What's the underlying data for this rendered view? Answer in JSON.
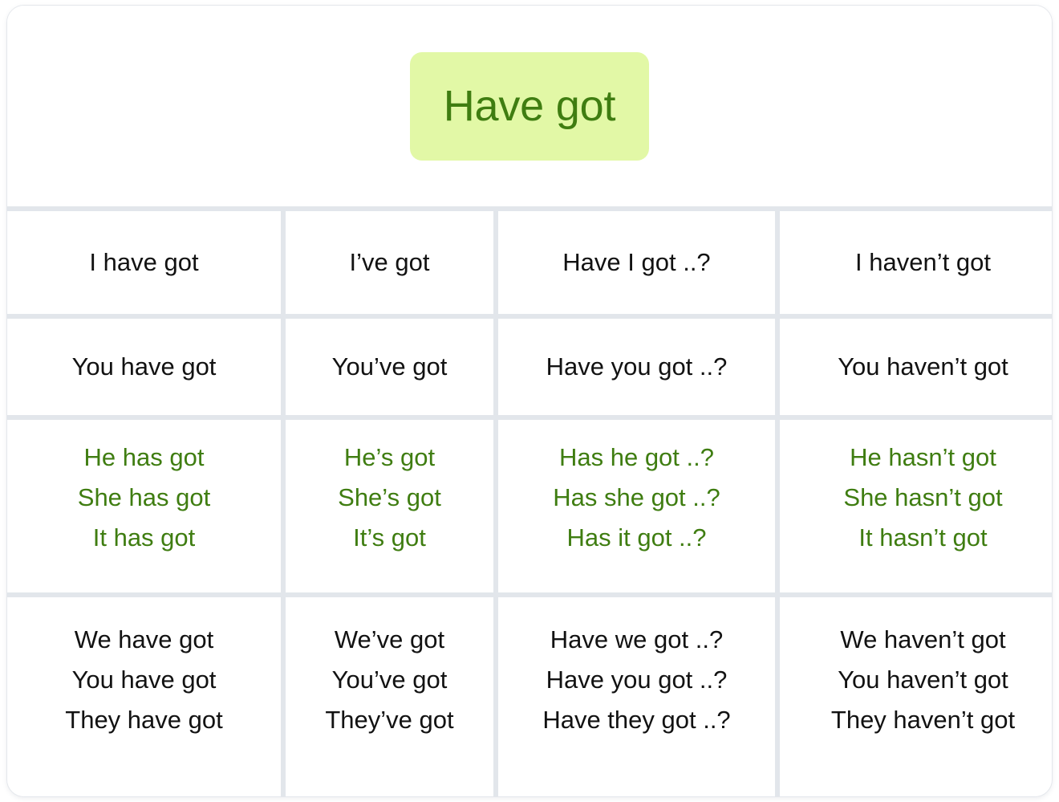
{
  "header": {
    "title": "Have got",
    "badge_bg_color": "#e2f8a6",
    "badge_text_color": "#3f7d11"
  },
  "colors": {
    "grid_line": "#e2e6eb",
    "cell_bg": "#ffffff",
    "text_default": "#121212",
    "text_green": "#3f7d11",
    "card_bg": "#ffffff"
  },
  "table": {
    "columns": [
      "affirmative-long",
      "affirmative-short",
      "question",
      "negative"
    ],
    "rows": [
      {
        "id": "row-1st-person-singular",
        "color": "default",
        "cells": [
          {
            "lines": [
              "I have got"
            ]
          },
          {
            "lines": [
              "I’ve got"
            ]
          },
          {
            "lines": [
              "Have I got ..?"
            ]
          },
          {
            "lines": [
              "I haven’t got"
            ]
          }
        ]
      },
      {
        "id": "row-2nd-person-singular",
        "color": "default",
        "cells": [
          {
            "lines": [
              "You have got"
            ]
          },
          {
            "lines": [
              "You’ve got"
            ]
          },
          {
            "lines": [
              "Have you got ..?"
            ]
          },
          {
            "lines": [
              "You haven’t got"
            ]
          }
        ]
      },
      {
        "id": "row-3rd-person-singular",
        "color": "green",
        "cells": [
          {
            "lines": [
              "He has got",
              "She has got",
              "It has got"
            ]
          },
          {
            "lines": [
              "He’s got",
              "She’s got",
              "It’s got"
            ]
          },
          {
            "lines": [
              "Has he got ..?",
              "Has she got ..?",
              "Has it got ..?"
            ]
          },
          {
            "lines": [
              "He hasn’t got",
              "She hasn’t got",
              "It hasn’t got"
            ]
          }
        ]
      },
      {
        "id": "row-plural",
        "color": "default",
        "cells": [
          {
            "lines": [
              "We have got",
              "You have got",
              "They have got"
            ]
          },
          {
            "lines": [
              "We’ve got",
              "You’ve got",
              "They’ve got"
            ]
          },
          {
            "lines": [
              "Have we got ..?",
              "Have you got ..?",
              "Have they got ..?"
            ]
          },
          {
            "lines": [
              "We haven’t got",
              "You haven’t got",
              "They haven’t got"
            ]
          }
        ]
      }
    ]
  }
}
